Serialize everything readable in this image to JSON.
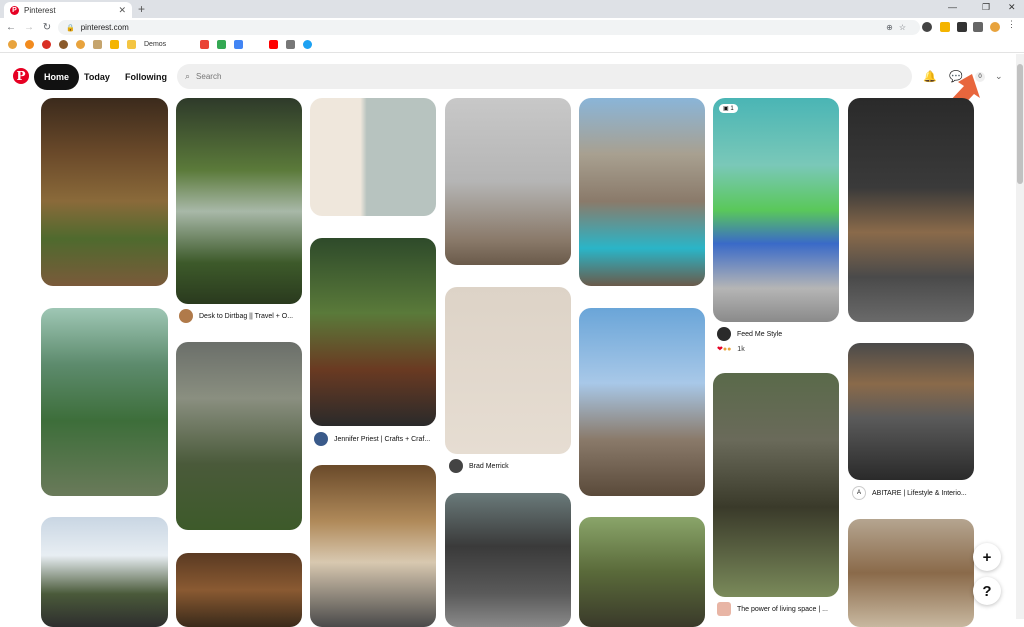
{
  "browser": {
    "tab_title": "Pinterest",
    "url": "pinterest.com",
    "bookmark_demos": "Demos"
  },
  "header": {
    "nav_home": "Home",
    "nav_today": "Today",
    "nav_following": "Following",
    "search_placeholder": "Search",
    "message_count": "0",
    "brand_color": "#e60023"
  },
  "pins": [
    {
      "source": "Desk to Dirtbag || Travel + O..."
    },
    {
      "source": "Jennifer Priest | Crafts + Craf..."
    },
    {
      "source": "Brad Merrick"
    },
    {
      "source": "Feed Me Style",
      "badge": "1",
      "reaction_count": "1k"
    },
    {
      "source": "ABITARE | Lifestyle & Interio..."
    },
    {
      "source": "The power of living space | ..."
    }
  ],
  "fab": {
    "add": "+",
    "help": "?"
  }
}
